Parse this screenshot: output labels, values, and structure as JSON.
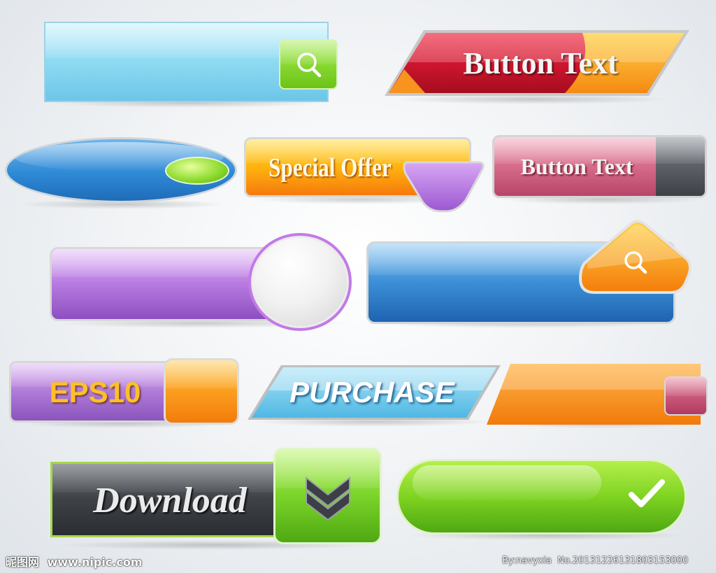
{
  "buttons": {
    "search_bar_top": {
      "icon": "search-icon"
    },
    "button_text_red": {
      "label": "Button Text"
    },
    "blue_oval": {},
    "special_offer": {
      "label": "Special Offer"
    },
    "button_text_pink": {
      "label": "Button Text"
    },
    "purple_circle_bar": {},
    "blue_search_bar": {
      "icon": "search-icon"
    },
    "eps10": {
      "label": "EPS10"
    },
    "purchase": {
      "label": "PURCHASE"
    },
    "orange_slant": {},
    "download": {
      "label": "Download",
      "icon": "double-chevron-down-icon"
    },
    "green_check": {
      "icon": "checkmark-icon"
    }
  },
  "watermark": {
    "site_cn": "昵图网",
    "site_url": "www.nipic.com",
    "credit": "By:navyxia  No.20131226131803153000"
  },
  "colors": {
    "blue": "#3b8fd6",
    "light_blue": "#7ccfee",
    "green": "#7bd42a",
    "red": "#c8102e",
    "orange": "#f7931e",
    "purple": "#a56bd6",
    "pink": "#c75b7a",
    "dark": "#3a3d40"
  }
}
